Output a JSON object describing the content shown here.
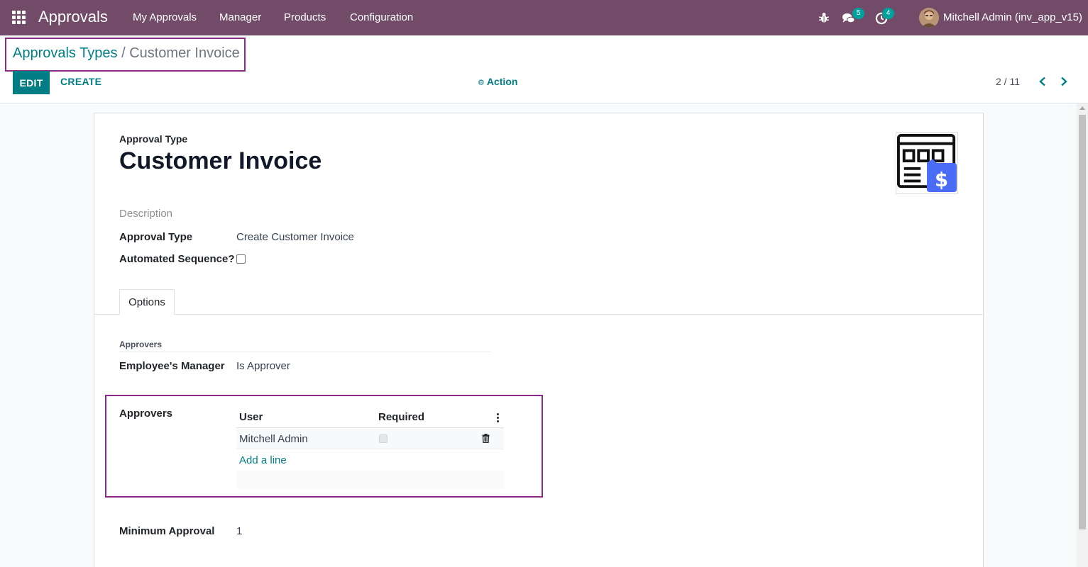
{
  "navbar": {
    "brand": "Approvals",
    "menu": [
      "My Approvals",
      "Manager",
      "Products",
      "Configuration"
    ],
    "messages_count": "5",
    "activities_count": "4",
    "user": "Mitchell Admin (inv_app_v15)"
  },
  "control_panel": {
    "breadcrumb_parent": "Approvals Types",
    "breadcrumb_sep": "/",
    "breadcrumb_current": "Customer Invoice",
    "edit_label": "EDIT",
    "create_label": "CREATE",
    "action_label": "Action",
    "pager": "2 / 11"
  },
  "form": {
    "name_label": "Approval Type",
    "name": "Customer Invoice",
    "description_label": "Description",
    "approval_type_label": "Approval Type",
    "approval_type_value": "Create Customer Invoice",
    "automated_sequence_label": "Automated Sequence?",
    "automated_sequence": false,
    "tabs": [
      "Options"
    ],
    "approvers_separator": "Approvers",
    "employee_manager_label": "Employee's Manager",
    "employee_manager_value": "Is Approver",
    "approvers_label": "Approvers",
    "table": {
      "columns": [
        "User",
        "Required"
      ],
      "rows": [
        {
          "user": "Mitchell Admin",
          "required": false
        }
      ],
      "add_line": "Add a line"
    },
    "minimum_approval_label": "Minimum Approval",
    "minimum_approval_value": "1"
  },
  "colors": {
    "navbar": "#714b67",
    "accent": "#017e84",
    "highlight_border": "#8b2b88"
  }
}
